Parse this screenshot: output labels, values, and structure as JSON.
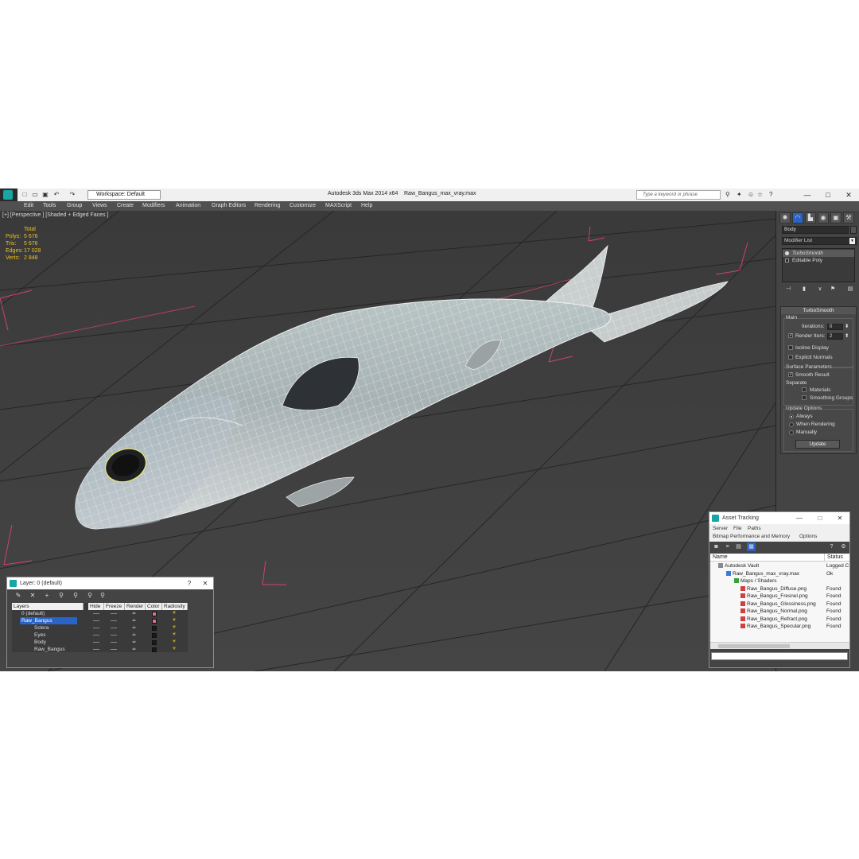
{
  "window": {
    "app_title": "Autodesk 3ds Max  2014 x64",
    "file_title": "Raw_Bangus_max_vray.max",
    "workspace": "Workspace: Default",
    "search_placeholder": "Type a keyword or phrase",
    "controls": {
      "minimize": "—",
      "maximize": "□",
      "close": "✕"
    }
  },
  "menu": [
    "Edit",
    "Tools",
    "Group",
    "Views",
    "Create",
    "Modifiers",
    "Animation",
    "Graph Editors",
    "Rendering",
    "Customize",
    "MAXScript",
    "Help"
  ],
  "viewport": {
    "label": "[+] [Perspective ] [Shaded + Edged Faces ]",
    "stats": {
      "header": "Total",
      "rows": [
        {
          "label": "Polys:",
          "value": "5 676"
        },
        {
          "label": "Tris:",
          "value": "5 676"
        },
        {
          "label": "Edges:",
          "value": "17 028"
        },
        {
          "label": "Verts:",
          "value": "2 848"
        }
      ]
    }
  },
  "command_panel": {
    "object_name": "Body",
    "modifier_list": "Modifier List",
    "stack": [
      {
        "label": "TurboSmooth",
        "selected": true
      },
      {
        "label": "Editable Poly",
        "selected": false
      }
    ],
    "turbosmooth": {
      "title": "TurboSmooth",
      "main_group": "Main",
      "iterations_label": "Iterations:",
      "iterations_value": "0",
      "render_iters_label": "Render Iters:",
      "render_iters_value": "2",
      "isoline_display": "Isoline Display",
      "explicit_normals": "Explicit Normals",
      "surface_group": "Surface Parameters",
      "smooth_result": "Smooth Result",
      "separate": "Separate",
      "materials": "Materials",
      "smoothing_groups": "Smoothing Groups",
      "update_group": "Update Options",
      "always": "Always",
      "when_rendering": "When Rendering",
      "manually": "Manually",
      "update_button": "Update"
    }
  },
  "layer_dialog": {
    "title": "Layer: 0 (default)",
    "help": "?",
    "close": "✕",
    "columns": [
      "Layers",
      "Hide",
      "Freeze",
      "Render",
      "Color",
      "Radiosity"
    ],
    "rows": [
      {
        "name": "0 (default)",
        "indent": 1,
        "color": "#e06ca0",
        "selected": false
      },
      {
        "name": "Raw_Bangus",
        "indent": 1,
        "color": "#e06ca0",
        "selected": true
      },
      {
        "name": "Sclera",
        "indent": 2,
        "color": "#1a1a1a",
        "selected": false
      },
      {
        "name": "Eyes",
        "indent": 2,
        "color": "#1a1a1a",
        "selected": false
      },
      {
        "name": "Body",
        "indent": 2,
        "color": "#1a1a1a",
        "selected": false
      },
      {
        "name": "Raw_Bangus",
        "indent": 2,
        "color": "#1a1a1a",
        "selected": false
      }
    ]
  },
  "asset_dialog": {
    "title": "Asset Tracking",
    "menu_row1": [
      "Server",
      "File",
      "Paths"
    ],
    "menu_row2": [
      "Bitmap Performance and Memory",
      "Options"
    ],
    "columns": [
      "Name",
      "Status"
    ],
    "rows": [
      {
        "name": "Autodesk Vault",
        "status": "Logged C",
        "indent": 0,
        "icon": "#8a8a8a"
      },
      {
        "name": "Raw_Bangus_max_vray.max",
        "status": "Ok",
        "indent": 1,
        "icon": "#3a7bd5"
      },
      {
        "name": "Maps / Shaders",
        "status": "",
        "indent": 2,
        "icon": "#3aa03a"
      },
      {
        "name": "Raw_Bangus_Diffuse.png",
        "status": "Found",
        "indent": 3,
        "icon": "#d04040"
      },
      {
        "name": "Raw_Bangus_Fresnel.png",
        "status": "Found",
        "indent": 3,
        "icon": "#d04040"
      },
      {
        "name": "Raw_Bangus_Glossiness.png",
        "status": "Found",
        "indent": 3,
        "icon": "#d04040"
      },
      {
        "name": "Raw_Bangus_Normal.png",
        "status": "Found",
        "indent": 3,
        "icon": "#d04040"
      },
      {
        "name": "Raw_Bangus_Refract.png",
        "status": "Found",
        "indent": 3,
        "icon": "#d04040"
      },
      {
        "name": "Raw_Bangus_Specular.png",
        "status": "Found",
        "indent": 3,
        "icon": "#d04040"
      }
    ]
  },
  "colors": {
    "accent": "#2a64c8",
    "stats": "#f0c020",
    "app_bg": "#444444",
    "logo": "#1aa5a5"
  }
}
